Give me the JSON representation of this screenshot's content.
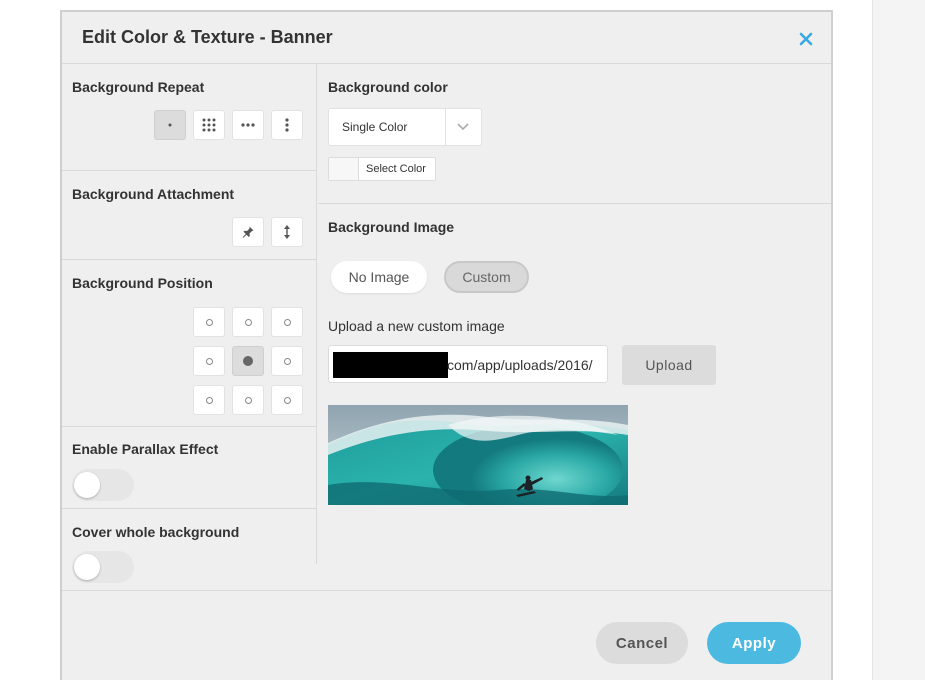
{
  "modal": {
    "title": "Edit Color & Texture - Banner",
    "accent_color": "#4cb9e1"
  },
  "left": {
    "repeat": {
      "label": "Background Repeat",
      "options": [
        {
          "icon": "no-repeat-icon",
          "active": true
        },
        {
          "icon": "repeat-icon",
          "active": false
        },
        {
          "icon": "repeat-x-icon",
          "active": false
        },
        {
          "icon": "repeat-y-icon",
          "active": false
        }
      ]
    },
    "attachment": {
      "label": "Background Attachment",
      "options": [
        {
          "icon": "pin-icon",
          "active": false
        },
        {
          "icon": "scroll-icon",
          "active": false
        }
      ]
    },
    "position": {
      "label": "Background Position",
      "selected": "center-center"
    },
    "parallax": {
      "label": "Enable Parallax Effect",
      "enabled": false
    },
    "cover": {
      "label": "Cover whole background",
      "enabled": false
    }
  },
  "right": {
    "color": {
      "label": "Background color",
      "select_value": "Single Color",
      "picker_label": "Select Color"
    },
    "image": {
      "label": "Background Image",
      "no_image_label": "No Image",
      "custom_label": "Custom",
      "selected": "Custom",
      "upload_label": "Upload a new custom image",
      "url_value": "com/app/uploads/2016/",
      "upload_button": "Upload"
    }
  },
  "footer": {
    "cancel": "Cancel",
    "apply": "Apply"
  }
}
